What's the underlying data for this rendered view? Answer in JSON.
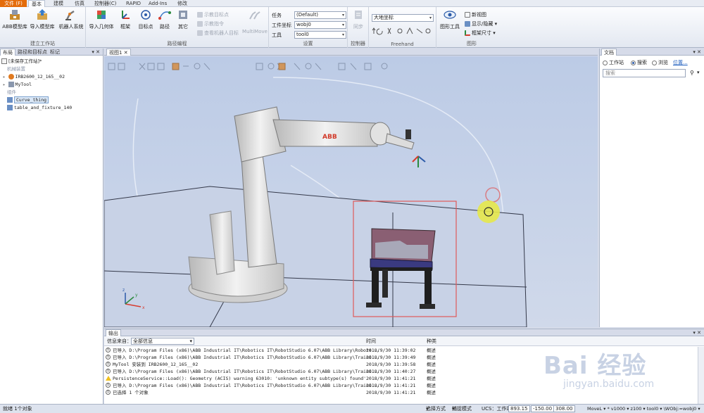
{
  "menubar": {
    "file": "文件 (F)",
    "tabs": [
      "基本",
      "建模",
      "仿真",
      "控制器(C)",
      "RAPID",
      "Add-Ins",
      "修改"
    ],
    "active_index": 0
  },
  "ribbon": {
    "group_build": {
      "label": "建立工作站",
      "buttons": [
        "ABB模型库",
        "导入模型库",
        "机器人系统"
      ]
    },
    "group_path": {
      "label": "路径编程",
      "buttons": [
        "导入几何体",
        "框架",
        "目标点",
        "路径",
        "其它"
      ],
      "small": [
        "示教目标点",
        "示教指令",
        "查看机器人目标"
      ],
      "multimove": "MultiMove"
    },
    "group_settings": {
      "label": "设置",
      "task_label": "任务",
      "task_value": "(Default)",
      "wobj_label": "工件坐标",
      "wobj_value": "wobj0",
      "tool_label": "工具",
      "tool_value": "tool0"
    },
    "group_controller": {
      "label": "控制器",
      "sync": "同步"
    },
    "group_freehand": {
      "label": "Freehand",
      "frame_value": "大地坐标"
    },
    "group_graphics": {
      "label": "图形",
      "view_tools": "图形工具",
      "new_view": "新视图",
      "show_hide": "显示/隐藏",
      "frame_size": "框架尺寸"
    }
  },
  "leftpanel": {
    "tabs": [
      "布局",
      "路径和目标点",
      "标记"
    ],
    "station_title": "[未保存工作站]*",
    "section_mechanisms": "机械装置",
    "robot": "IRB2600_12_165__02",
    "tool": "MyTool",
    "section_parts": "组件",
    "part1": "Curve_thing",
    "part2": "table_and_fixture_140"
  },
  "viewport": {
    "tab": "视图1"
  },
  "scene": {
    "brand_text": "ABB"
  },
  "rightpanel": {
    "title": "文档",
    "radio_station": "工作站",
    "radio_search": "搜索",
    "radio_browse": "浏览",
    "location_link": "位置...",
    "search_placeholder": "搜索"
  },
  "output": {
    "title": "输出",
    "col_source": "信息来自：",
    "source_value": "全部信息",
    "col_time": "时间",
    "col_category": "种类",
    "rows": [
      {
        "msg": "已导入 D:\\Program Files (x86)\\ABB Industrial IT\\Robotics IT\\RobotStudio 6.07\\ABB Library\\Robots...",
        "time": "2018/9/30 11:39:02",
        "cat": "概述",
        "warn": false
      },
      {
        "msg": "已导入 D:\\Program Files (x86)\\ABB Industrial IT\\Robotics IT\\RobotStudio 6.07\\ABB Library\\Traini...",
        "time": "2018/9/30 11:39:49",
        "cat": "概述",
        "warn": false
      },
      {
        "msg": "MyTool 安装到 IRB2600_12_165__02",
        "time": "2018/9/30 11:39:58",
        "cat": "概述",
        "warn": false
      },
      {
        "msg": "已导入 D:\\Program Files (x86)\\ABB Industrial IT\\Robotics IT\\RobotStudio 6.07\\ABB Library\\Traini...",
        "time": "2018/9/30 11:40:27",
        "cat": "概述",
        "warn": false
      },
      {
        "msg": "PersistenceService::Load(): Geometry (ACIS) warning 63010: 'unknown entity subtype(s) found'",
        "time": "2018/9/30 11:41:21",
        "cat": "概述",
        "warn": true
      },
      {
        "msg": "已导入 D:\\Program Files (x86)\\ABB Industrial IT\\Robotics IT\\RobotStudio 6.07\\ABB Library\\Traini...",
        "time": "2018/9/30 11:41:21",
        "cat": "概述",
        "warn": false
      },
      {
        "msg": "已选择 1 个对象",
        "time": "2018/9/30 11:41:21",
        "cat": "概述",
        "warn": false
      }
    ]
  },
  "statusbar": {
    "left": "就绪 1个对象",
    "select_mode": "选择方式",
    "snap_mode": "捕捉模式",
    "ucs": "UCS：工作站",
    "x": "893.15",
    "y": "-150.00",
    "z": "308.00",
    "right": "MoveL ▾ * v1000 ▾ z100 ▾ tool0 ▾ \\WObj:=wobj0 ▾"
  },
  "watermark": {
    "logo": "Bai  经验",
    "url": "jingyan.baidu.com"
  },
  "colors": {
    "file_tab": "#e46c0a",
    "viewport_bg": "#c3cfe7",
    "selection_box": "#e05a5a",
    "robot": "#e6e6e6"
  }
}
